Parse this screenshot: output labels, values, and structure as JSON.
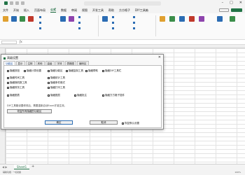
{
  "menubar": {
    "items": [
      "文件",
      "开始",
      "插入",
      "页面布局",
      "公式",
      "数据",
      "审阅",
      "视图",
      "开发工具",
      "帮助",
      "方方格子",
      "DIY工具箱"
    ],
    "active_index": 4
  },
  "ribbon": {
    "groups": [
      "编辑",
      "选择",
      "高级",
      "数值",
      "统计",
      "汇总",
      "工具"
    ]
  },
  "sheets": {
    "tabs": [
      "Sheet1"
    ],
    "add": "+"
  },
  "status": {
    "left": "辅助功能: 一切就绪",
    "zoom": "100%"
  },
  "dialog": {
    "title": "高级设置",
    "close": "✕",
    "tabs": [
      "功能区",
      "显示",
      "注释",
      "其他",
      "高级",
      "字体",
      "表格图",
      "编码区"
    ],
    "active_tab": 0,
    "checkboxes": [
      "隐藏按钮",
      "隐藏计算设置",
      "隐藏功能区",
      "隐藏复制工具",
      "隐藏帮助",
      "隐藏DIY工具栏",
      "隐藏时间工具",
      "隐藏统计工具",
      "隐藏随机数工具",
      "隐藏条件格式",
      "隐藏财务工具",
      "隐藏打印工具",
      "隐藏图表",
      "隐藏图层",
      "隐藏批注",
      "隐藏方方格子插件"
    ],
    "hint": "DIY工具箱设置修改后，需要重新启动Excel才能生效。",
    "restore_button": "恢复所有隐藏的功能区",
    "confirm_button": "确定",
    "cancel_button": "取消",
    "reset_checkbox": "恢复默认设置"
  },
  "colors": {
    "accent": "#217346",
    "link": "#1a50a0"
  }
}
